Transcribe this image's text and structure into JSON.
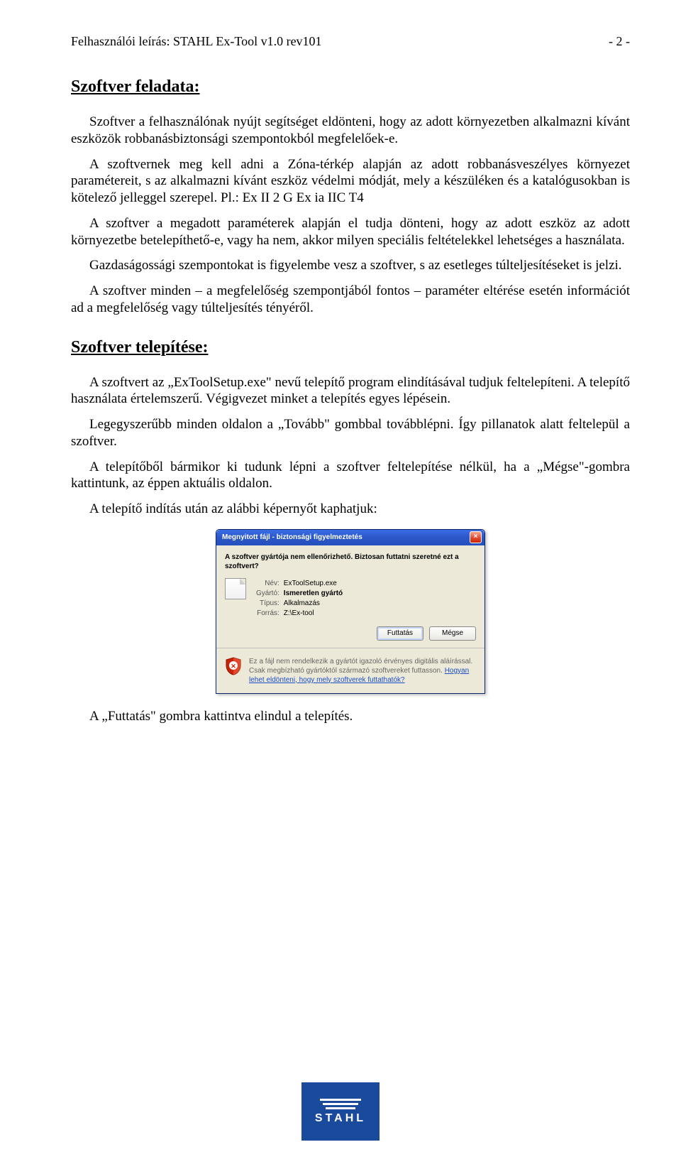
{
  "header": {
    "left": "Felhasználói leírás: STAHL Ex-Tool v1.0 rev101",
    "right": "- 2 -"
  },
  "section1": {
    "title": "Szoftver feladata:",
    "p1": "Szoftver a felhasználónak nyújt segítséget eldönteni, hogy az adott környezetben alkalmazni kívánt eszközök robbanásbiztonsági szempontokból megfelelőek-e.",
    "p2": "A szoftvernek meg kell adni a Zóna-térkép alapján az adott robbanásveszélyes környezet paramétereit, s az alkalmazni kívánt eszköz védelmi módját, mely a készüléken és a katalógusokban is kötelező jelleggel szerepel. Pl.: Ex II 2 G Ex ia IIC T4",
    "p3": "A szoftver a megadott paraméterek alapján el tudja dönteni, hogy az adott eszköz az adott környezetbe betelepíthető-e, vagy ha nem, akkor milyen speciális feltételekkel lehetséges a használata.",
    "p4": "Gazdaságossági szempontokat is figyelembe vesz a szoftver, s az esetleges túlteljesítéseket is jelzi.",
    "p5": "A szoftver minden – a megfelelőség szempontjából fontos – paraméter eltérése esetén információt ad a megfelelőség vagy túlteljesítés tényéről."
  },
  "section2": {
    "title": "Szoftver telepítése:",
    "p1": "A szoftvert az „ExToolSetup.exe\" nevű telepítő program elindításával tudjuk feltelepíteni. A telepítő használata értelemszerű. Végigvezet minket a telepítés egyes lépésein.",
    "p2": "Legegyszerűbb minden oldalon a „Tovább\" gombbal továbblépni. Így pillanatok alatt feltelepül a szoftver.",
    "p3": "A telepítőből bármikor ki tudunk lépni a szoftver feltelepítése nélkül, ha a „Mégse\"-gombra kattintunk, az éppen aktuális oldalon.",
    "p4": "A telepítő indítás után az alábbi képernyőt kaphatjuk:",
    "p5": "A „Futtatás\" gombra kattintva elindul a telepítés."
  },
  "dialog": {
    "title": "Megnyitott fájl - biztonsági figyelmeztetés",
    "question": "A szoftver gyártója nem ellenőrizhető. Biztosan futtatni szeretné ezt a szoftvert?",
    "nameLabel": "Név:",
    "nameValue": "ExToolSetup.exe",
    "vendorLabel": "Gyártó:",
    "vendorValue": "Ismeretlen gyártó",
    "typeLabel": "Típus:",
    "typeValue": "Alkalmazás",
    "sourceLabel": "Forrás:",
    "sourceValue": "Z:\\Ex-tool",
    "runBtn": "Futtatás",
    "cancelBtn": "Mégse",
    "warnText": "Ez a fájl nem rendelkezik a gyártót igazoló érvényes digitális aláírással. Csak megbízható gyártóktól származó szoftvereket futtasson. ",
    "warnLink": "Hogyan lehet eldönteni, hogy mely szoftverek futtathatók?"
  },
  "logo": {
    "text": "STAHL"
  }
}
